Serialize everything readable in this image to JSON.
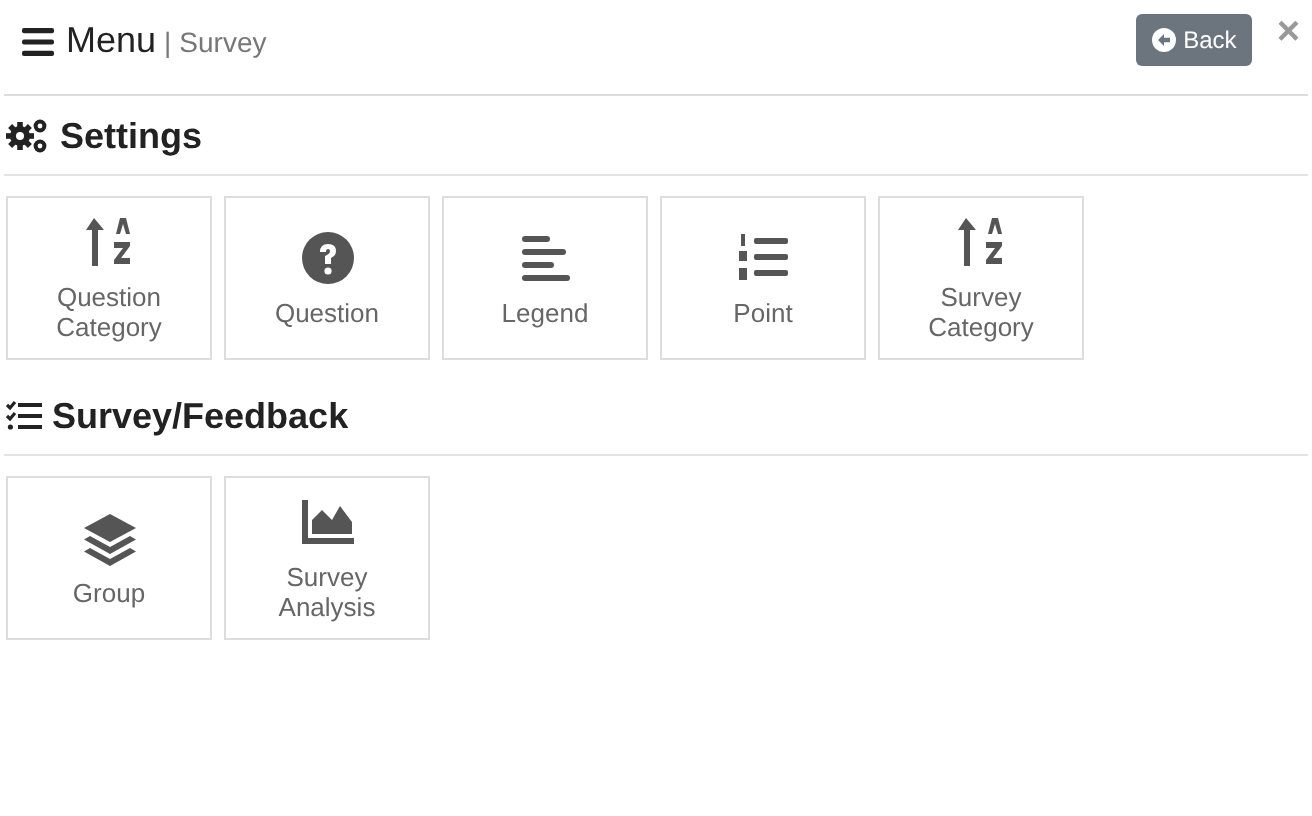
{
  "header": {
    "menu_label": "Menu",
    "separator": "|",
    "page": "Survey",
    "back_button": "Back",
    "close": "×"
  },
  "sections": [
    {
      "title": "Settings",
      "tiles": [
        {
          "label": "Question Category"
        },
        {
          "label": "Question"
        },
        {
          "label": "Legend"
        },
        {
          "label": "Point"
        },
        {
          "label": "Survey Category"
        }
      ]
    },
    {
      "title": "Survey/Feedback",
      "tiles": [
        {
          "label": "Group"
        },
        {
          "label": "Survey Analysis"
        }
      ]
    }
  ]
}
